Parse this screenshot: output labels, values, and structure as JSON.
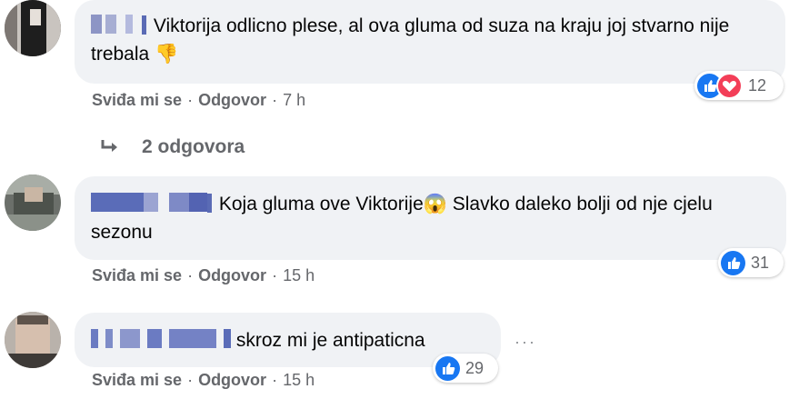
{
  "comments": [
    {
      "text": "Viktorija odlicno plese, al ova gluma od suza na kraju joj stvarno nije trebala",
      "emoji": "👎",
      "actions": {
        "like": "Sviđa mi se",
        "reply": "Odgovor",
        "time": "7 h"
      },
      "reactions": {
        "count": "12",
        "types": [
          "like",
          "love"
        ]
      }
    },
    {
      "text": "Koja gluma ove Viktorije",
      "emoji": "😱",
      "text_after": "Slavko daleko bolji od nje cjelu sezonu",
      "actions": {
        "like": "Sviđa mi se",
        "reply": "Odgovor",
        "time": "15 h"
      },
      "reactions": {
        "count": "31",
        "types": [
          "like"
        ]
      }
    },
    {
      "text": "skroz mi je antipaticna",
      "actions": {
        "like": "Sviđa mi se",
        "reply": "Odgovor",
        "time": "15 h"
      },
      "reactions": {
        "count": "29",
        "types": [
          "like"
        ]
      }
    }
  ],
  "replies": {
    "label": "2 odgovora",
    "icon": "reply-arrow-icon"
  },
  "more_options": "···",
  "colors": {
    "bubble": "#f0f2f5",
    "meta": "#65676b",
    "like": "#1877f2",
    "love": "#f33e58"
  }
}
